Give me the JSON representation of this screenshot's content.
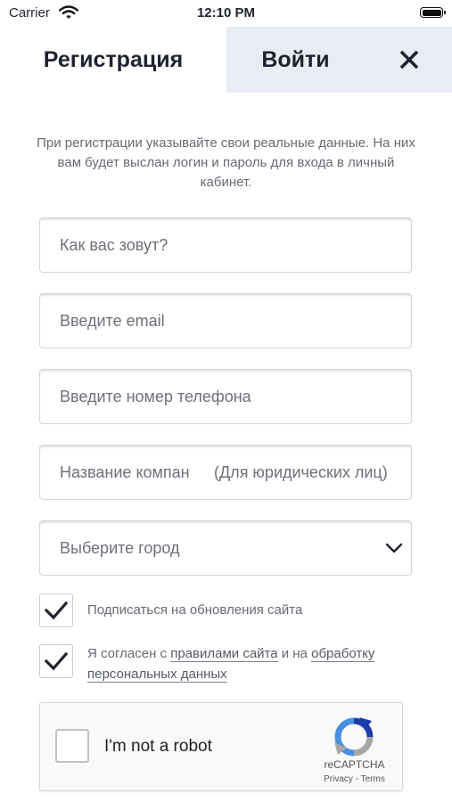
{
  "status_bar": {
    "carrier": "Carrier",
    "time": "12:10 PM"
  },
  "tabs": {
    "register": "Регистрация",
    "login": "Войти"
  },
  "intro": "При регистрации указывайте свои реальные данные. На них вам будет выслан логин и пароль для входа в личный кабинет.",
  "form": {
    "name_placeholder": "Как вас зовут?",
    "email_placeholder": "Введите email",
    "phone_placeholder": "Введите номер телефона",
    "company_placeholder": "Название компан",
    "company_hint": "(Для юридических лиц)",
    "city_placeholder": "Выберите город"
  },
  "checkboxes": {
    "subscribe": {
      "label": "Подписаться на обновления сайта",
      "checked": true
    },
    "agree": {
      "prefix": "Я согласен с ",
      "rules_link": "правилами сайта",
      "middle": " и на ",
      "processing_link1": "обработку",
      "processing_link2": "персональных данных",
      "checked": true
    }
  },
  "recaptcha": {
    "label": "I'm not a robot",
    "brand": "reCAPTCHA",
    "privacy": "Privacy",
    "separator": " - ",
    "terms": "Terms"
  }
}
